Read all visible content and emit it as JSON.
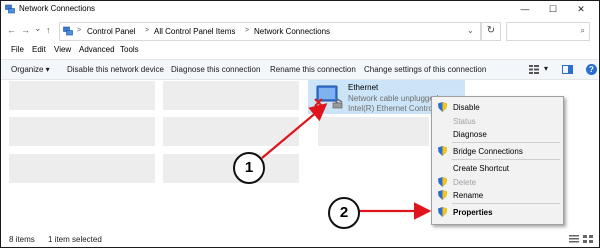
{
  "window": {
    "title": "Network Connections",
    "minimize_glyph": "—",
    "maximize_glyph": "☐",
    "close_glyph": "✕"
  },
  "address_bar": {
    "back_glyph": "←",
    "forward_glyph": "→",
    "recent_glyph": "⌄",
    "up_glyph": "↑",
    "crumbs": [
      "Control Panel",
      "All Control Panel Items",
      "Network Connections"
    ],
    "separator": ">",
    "refresh_glyph": "↻",
    "search_glyph": "⌕"
  },
  "menu": [
    "File",
    "Edit",
    "View",
    "Advanced",
    "Tools"
  ],
  "command_bar": {
    "organize": "Organize ▾",
    "items": [
      "Disable this network device",
      "Diagnose this connection",
      "Rename this connection",
      "Change settings of this connection"
    ],
    "view_arrow": "▾",
    "help_glyph": "?"
  },
  "ethernet": {
    "name": "Ethernet",
    "status": "Network cable unplugged",
    "adapter": "Intel(R) Ethernet Controller"
  },
  "context_menu": [
    {
      "label": "Disable",
      "shield": true,
      "disabled": false,
      "bold": false
    },
    {
      "label": "Status",
      "shield": false,
      "disabled": true,
      "bold": false
    },
    {
      "label": "Diagnose",
      "shield": false,
      "disabled": false,
      "bold": false
    },
    {
      "label": "Bridge Connections",
      "shield": true,
      "disabled": false,
      "bold": false
    },
    {
      "label": "Create Shortcut",
      "shield": false,
      "disabled": false,
      "bold": false
    },
    {
      "label": "Delete",
      "shield": true,
      "disabled": true,
      "bold": false
    },
    {
      "label": "Rename",
      "shield": true,
      "disabled": false,
      "bold": false
    },
    {
      "label": "Properties",
      "shield": true,
      "disabled": false,
      "bold": true
    }
  ],
  "status_bar": {
    "items_count": "8 items",
    "selected": "1 item selected"
  },
  "callouts": [
    "1",
    "2"
  ],
  "colors": {
    "selection": "#cce4f7",
    "arrow": "#e0141c",
    "shield_blue": "#2b6fcc",
    "shield_yellow": "#f5c518",
    "placeholder_tile": "#ededed"
  },
  "icons": [
    "app-network-icon",
    "back-arrow-icon",
    "forward-arrow-icon",
    "up-arrow-icon",
    "refresh-icon",
    "search-icon",
    "ethernet-adapter-icon",
    "uac-shield-icon",
    "help-icon",
    "view-options-icon"
  ]
}
